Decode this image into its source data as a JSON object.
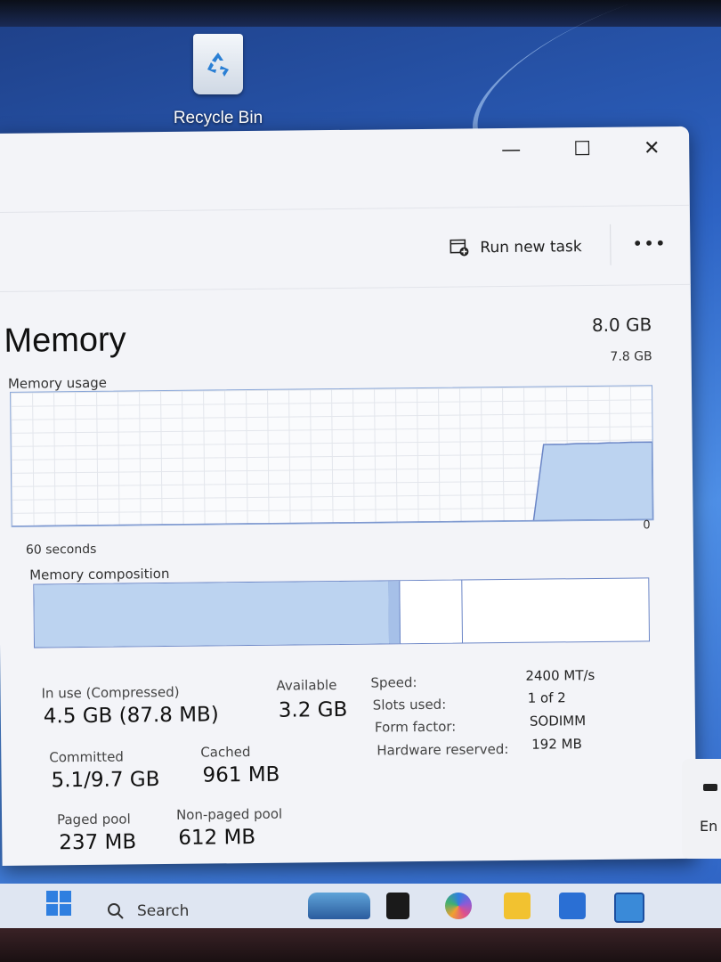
{
  "desktop": {
    "recycle_bin_label": "Recycle Bin"
  },
  "window": {
    "controls": {
      "minimize": "—",
      "maximize": "☐",
      "close": "✕"
    },
    "toolbar": {
      "run_new_task": "Run new task",
      "more": "•••"
    }
  },
  "memory": {
    "title": "Memory",
    "total": "8.0 GB",
    "usage_label": "Memory usage",
    "usage_max": "7.8 GB",
    "usage_min": "0",
    "time_span": "60 seconds",
    "composition_label": "Memory composition",
    "stats": {
      "in_use_label": "In use (Compressed)",
      "in_use_value": "4.5 GB (87.8 MB)",
      "available_label": "Available",
      "available_value": "3.2 GB",
      "committed_label": "Committed",
      "committed_value": "5.1/9.7 GB",
      "cached_label": "Cached",
      "cached_value": "961 MB",
      "paged_pool_label": "Paged pool",
      "paged_pool_value": "237 MB",
      "non_paged_pool_label": "Non-paged pool",
      "non_paged_pool_value": "612 MB"
    },
    "specs": {
      "speed_label": "Speed:",
      "speed_value": "2400 MT/s",
      "slots_label": "Slots used:",
      "slots_value": "1 of 2",
      "form_label": "Form factor:",
      "form_value": "SODIMM",
      "reserved_label": "Hardware reserved:",
      "reserved_value": "192 MB"
    },
    "graph_series": [
      0,
      0,
      0,
      0,
      0,
      0,
      0,
      0,
      0,
      0,
      0,
      0,
      0,
      0,
      0,
      0,
      0,
      0,
      0,
      0,
      0,
      0,
      0,
      0,
      0,
      0,
      0,
      0,
      0,
      0,
      0,
      0,
      0,
      0,
      0,
      0,
      0,
      0,
      0,
      0,
      0,
      0,
      0,
      0,
      0,
      0,
      0,
      0,
      0,
      0.57,
      0.57,
      0.57,
      0.575,
      0.575,
      0.575,
      0.578,
      0.578,
      0.58,
      0.58,
      0.58
    ]
  },
  "taskbar": {
    "search_label": "Search"
  },
  "tray": {
    "language": "En"
  },
  "colors": {
    "graph_fill": "#bcd3f0",
    "graph_line": "#6a85c6",
    "accent": "#2f7fe0"
  }
}
